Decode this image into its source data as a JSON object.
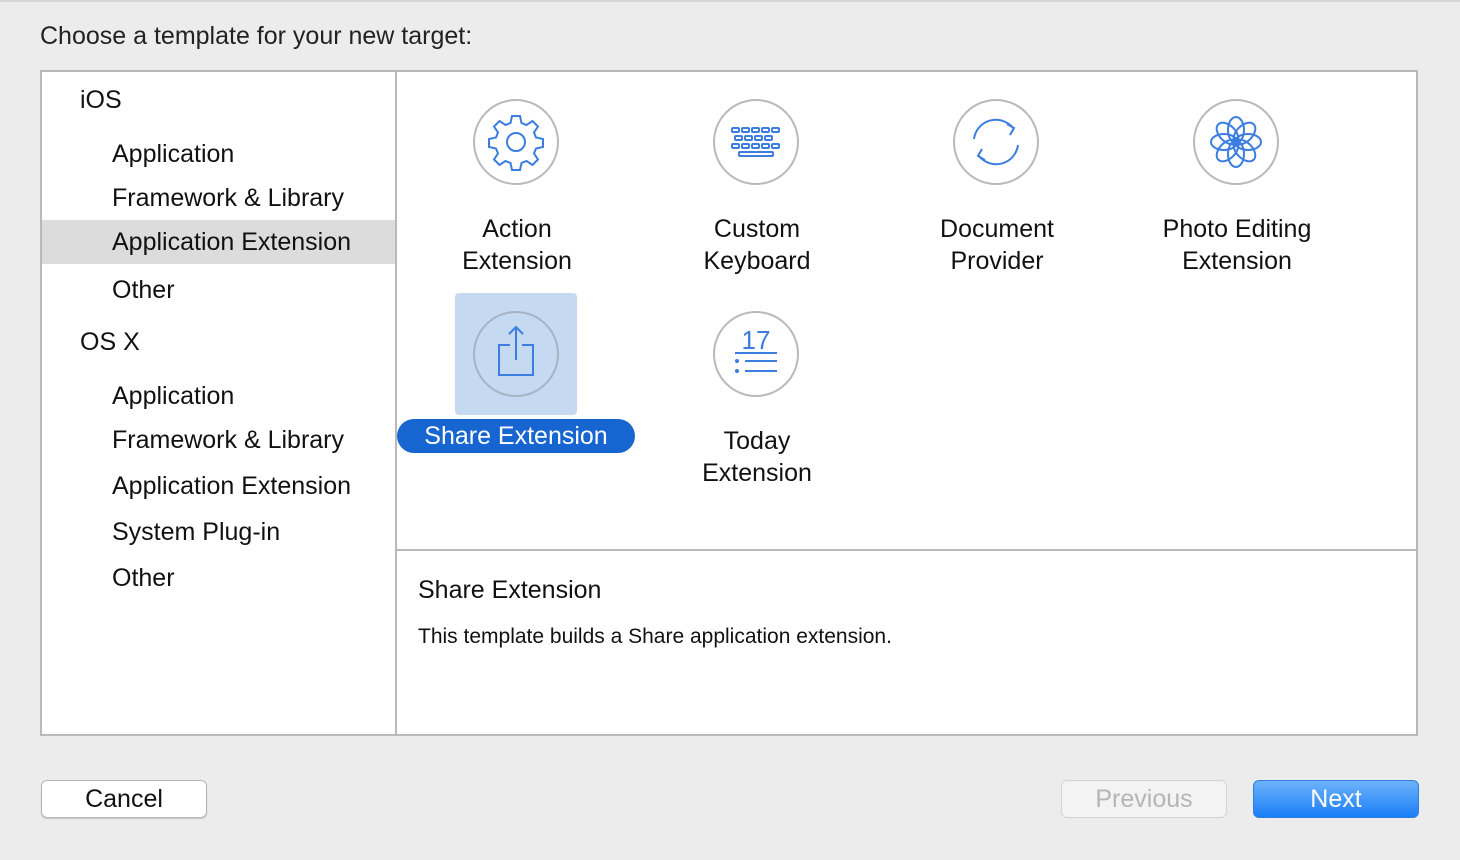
{
  "prompt": "Choose a template for your new target:",
  "sidebar": {
    "sections": [
      {
        "label": "iOS",
        "items": [
          "Application",
          "Framework & Library",
          "Application Extension",
          "Other"
        ]
      },
      {
        "label": "OS X",
        "items": [
          "Application",
          "Framework & Library",
          "Application Extension",
          "System Plug-in",
          "Other"
        ]
      }
    ],
    "selected": "iOS / Application Extension"
  },
  "templates": [
    {
      "line1": "Action",
      "line2": "Extension",
      "icon": "gear-icon"
    },
    {
      "line1": "Custom",
      "line2": "Keyboard",
      "icon": "keyboard-icon"
    },
    {
      "line1": "Document",
      "line2": "Provider",
      "icon": "sync-arrows-icon"
    },
    {
      "line1": "Photo Editing",
      "line2": "Extension",
      "icon": "flower-icon"
    },
    {
      "line1": "Share Extension",
      "line2": "",
      "icon": "share-icon",
      "selected": true
    },
    {
      "line1": "Today",
      "line2": "Extension",
      "icon": "calendar-list-icon",
      "icon_text": "17"
    }
  ],
  "description": {
    "title": "Share Extension",
    "body": "This template builds a Share application extension."
  },
  "buttons": {
    "cancel": "Cancel",
    "previous": "Previous",
    "next": "Next"
  },
  "colors": {
    "accent": "#1665d0",
    "icon_blue": "#3b7de0",
    "selection_bg": "#c5d9f0",
    "sidebar_selected": "#dcdcdc"
  }
}
